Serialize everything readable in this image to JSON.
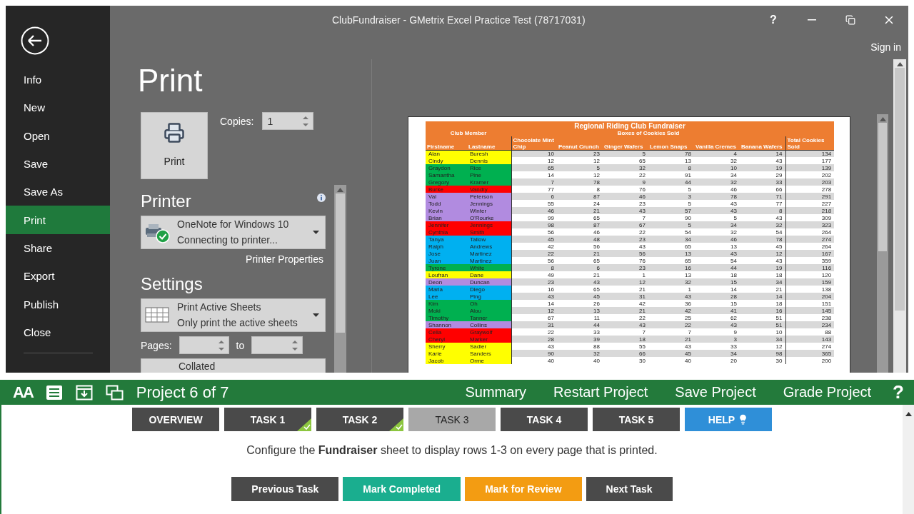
{
  "window": {
    "title": "ClubFundraiser -  GMetrix Excel Practice Test (78717031)",
    "help": "?",
    "sign_in": "Sign in"
  },
  "backstage": {
    "items": [
      {
        "label": "Info",
        "selected": false
      },
      {
        "label": "New",
        "selected": false
      },
      {
        "label": "Open",
        "selected": false
      },
      {
        "label": "Save",
        "selected": false
      },
      {
        "label": "Save As",
        "selected": false
      },
      {
        "label": "Print",
        "selected": true
      },
      {
        "label": "Share",
        "selected": false
      },
      {
        "label": "Export",
        "selected": false
      },
      {
        "label": "Publish",
        "selected": false
      },
      {
        "label": "Close",
        "selected": false
      }
    ]
  },
  "print": {
    "heading": "Print",
    "print_button": "Print",
    "copies_label": "Copies:",
    "copies_value": "1",
    "printer_heading": "Printer",
    "printer": {
      "name": "OneNote for Windows 10",
      "status": "Connecting to printer..."
    },
    "printer_properties": "Printer Properties",
    "settings_heading": "Settings",
    "scope": {
      "title": "Print Active Sheets",
      "subtitle": "Only print the active sheets"
    },
    "pages_label": "Pages:",
    "pages_to": "to",
    "collated": "Collated"
  },
  "preview": {
    "table": {
      "title": "Regional Riding Club Fundraiser",
      "club_member": "Club Member",
      "boxes_sold": "Boxes of Cookies Sold",
      "columns": [
        "Firstname",
        "Lastname",
        "Chocolate Mint Chip",
        "Peanut Crunch",
        "Ginger Wafers",
        "Lemon Snaps",
        "Vanilla Cremes",
        "Banana Wafers",
        "Total Cookies Sold"
      ],
      "rows": [
        {
          "color": "#ffff00",
          "cells": [
            "Alan",
            "Buresh",
            "10",
            "23",
            "5",
            "78",
            "4",
            "14",
            "134"
          ]
        },
        {
          "color": "#ffff00",
          "cells": [
            "Cindy",
            "Dennis",
            "12",
            "12",
            "65",
            "13",
            "32",
            "43",
            "177"
          ]
        },
        {
          "color": "#00b050",
          "cells": [
            "Graydon",
            "Rice",
            "65",
            "5",
            "32",
            "8",
            "10",
            "19",
            "139"
          ]
        },
        {
          "color": "#00b050",
          "cells": [
            "Samantha",
            "Pine",
            "14",
            "12",
            "22",
            "91",
            "34",
            "29",
            "202"
          ]
        },
        {
          "color": "#00b050",
          "cells": [
            "Gregory",
            "Kramer",
            "7",
            "78",
            "9",
            "44",
            "32",
            "33",
            "203"
          ]
        },
        {
          "color": "#ff0000",
          "cells": [
            "Burke",
            "Vandry",
            "77",
            "8",
            "76",
            "5",
            "46",
            "66",
            "278"
          ]
        },
        {
          "color": "#b18be0",
          "cells": [
            "Val",
            "Peterson",
            "6",
            "87",
            "46",
            "3",
            "78",
            "71",
            "291"
          ]
        },
        {
          "color": "#b18be0",
          "cells": [
            "Todd",
            "Jennings",
            "55",
            "24",
            "23",
            "5",
            "43",
            "77",
            "227"
          ]
        },
        {
          "color": "#b18be0",
          "cells": [
            "Kevin",
            "Winter",
            "46",
            "21",
            "43",
            "57",
            "43",
            "8",
            "218"
          ]
        },
        {
          "color": "#b18be0",
          "cells": [
            "Brian",
            "O'Rourke",
            "99",
            "65",
            "7",
            "90",
            "5",
            "43",
            "309"
          ]
        },
        {
          "color": "#ff0000",
          "cells": [
            "Jennifer",
            "Jennings",
            "98",
            "87",
            "67",
            "5",
            "34",
            "32",
            "323"
          ]
        },
        {
          "color": "#ff0000",
          "cells": [
            "Cynthia",
            "Smith",
            "56",
            "46",
            "22",
            "54",
            "32",
            "54",
            "264"
          ]
        },
        {
          "color": "#00b0f0",
          "cells": [
            "Tanya",
            "Tallow",
            "45",
            "48",
            "23",
            "34",
            "46",
            "78",
            "274"
          ]
        },
        {
          "color": "#00b0f0",
          "cells": [
            "Ralph",
            "Andrews",
            "42",
            "56",
            "43",
            "65",
            "13",
            "45",
            "264"
          ]
        },
        {
          "color": "#00b0f0",
          "cells": [
            "Jose",
            "Martinez",
            "22",
            "21",
            "56",
            "13",
            "43",
            "12",
            "167"
          ]
        },
        {
          "color": "#00b0f0",
          "cells": [
            "Juan",
            "Martinez",
            "56",
            "65",
            "76",
            "65",
            "54",
            "43",
            "359"
          ]
        },
        {
          "color": "#00b050",
          "cells": [
            "Tyrone",
            "White",
            "8",
            "6",
            "23",
            "16",
            "44",
            "19",
            "116"
          ]
        },
        {
          "color": "#ffff00",
          "cells": [
            "Loufran",
            "Dane",
            "49",
            "21",
            "1",
            "13",
            "18",
            "18",
            "120"
          ]
        },
        {
          "color": "#b18be0",
          "cells": [
            "Deon",
            "Duncan",
            "23",
            "43",
            "12",
            "32",
            "15",
            "34",
            "159"
          ]
        },
        {
          "color": "#00b0f0",
          "cells": [
            "Maria",
            "Diego",
            "16",
            "65",
            "21",
            "1",
            "14",
            "21",
            "138"
          ]
        },
        {
          "color": "#00b0f0",
          "cells": [
            "Lee",
            "Ping",
            "43",
            "45",
            "31",
            "43",
            "28",
            "14",
            "204"
          ]
        },
        {
          "color": "#00b050",
          "cells": [
            "Kim",
            "Oh",
            "14",
            "26",
            "42",
            "36",
            "15",
            "18",
            "151"
          ]
        },
        {
          "color": "#00b050",
          "cells": [
            "Moki",
            "Alou",
            "12",
            "13",
            "21",
            "42",
            "41",
            "16",
            "145"
          ]
        },
        {
          "color": "#00b050",
          "cells": [
            "Timothy",
            "Tanner",
            "67",
            "11",
            "22",
            "25",
            "62",
            "51",
            "238"
          ]
        },
        {
          "color": "#b18be0",
          "cells": [
            "Shannon",
            "Collins",
            "31",
            "44",
            "43",
            "22",
            "43",
            "51",
            "234"
          ]
        },
        {
          "color": "#ff0000",
          "cells": [
            "Celia",
            "Graywolf",
            "22",
            "33",
            "7",
            "7",
            "9",
            "10",
            "88"
          ]
        },
        {
          "color": "#ff0000",
          "cells": [
            "Cheryl",
            "Marker",
            "28",
            "39",
            "18",
            "21",
            "3",
            "34",
            "143"
          ]
        },
        {
          "color": "#ffff00",
          "cells": [
            "Sherry",
            "Sadler",
            "43",
            "88",
            "55",
            "43",
            "33",
            "12",
            "274"
          ]
        },
        {
          "color": "#ffff00",
          "cells": [
            "Karie",
            "Sanders",
            "90",
            "32",
            "66",
            "45",
            "34",
            "98",
            "365"
          ]
        },
        {
          "color": "#ffff00",
          "cells": [
            "Jacob",
            "Orme",
            "40",
            "40",
            "30",
            "40",
            "20",
            "30",
            "200"
          ]
        }
      ]
    }
  },
  "project_bar": {
    "text_size": "AA",
    "project": "Project 6 of 7",
    "links": [
      "Summary",
      "Restart Project",
      "Save Project",
      "Grade Project"
    ],
    "help": "?"
  },
  "tasks": {
    "tabs": [
      {
        "label": "OVERVIEW",
        "kind": "task",
        "selected": false,
        "completed": false
      },
      {
        "label": "TASK 1",
        "kind": "task",
        "selected": false,
        "completed": true
      },
      {
        "label": "TASK 2",
        "kind": "task",
        "selected": false,
        "completed": true
      },
      {
        "label": "TASK 3",
        "kind": "task",
        "selected": true,
        "completed": false
      },
      {
        "label": "TASK 4",
        "kind": "task",
        "selected": false,
        "completed": false
      },
      {
        "label": "TASK 5",
        "kind": "task",
        "selected": false,
        "completed": false
      },
      {
        "label": "HELP",
        "kind": "help",
        "selected": false,
        "completed": false
      }
    ],
    "instruction": "Configure the **Fundraiser** sheet to display rows 1-3 on every page that is printed.",
    "buttons": [
      {
        "label": "Previous Task",
        "kind": "neutral"
      },
      {
        "label": "Mark Completed",
        "kind": "complete"
      },
      {
        "label": "Mark for Review",
        "kind": "review"
      },
      {
        "label": "Next Task",
        "kind": "neutral"
      }
    ]
  }
}
